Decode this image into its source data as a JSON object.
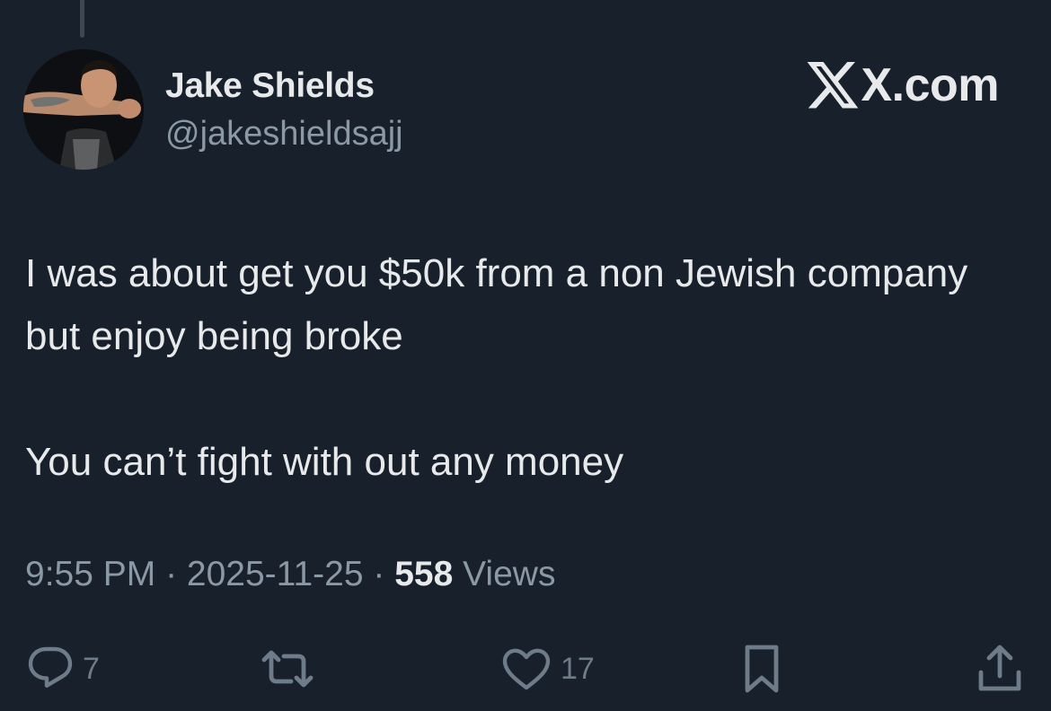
{
  "tweet": {
    "author": {
      "name": "Jake Shields",
      "handle": "@jakeshieldsajj"
    },
    "brand": {
      "text": "X.com"
    },
    "paragraphs": [
      "I was about get you $50k from a non Jewish company but enjoy being broke",
      "You can’t fight with out any money"
    ],
    "meta": {
      "time": "9:55 PM",
      "separator": " · ",
      "date": "2025-11-25",
      "views_count": "558",
      "views_label": "Views"
    },
    "actions": {
      "replies": "7",
      "likes": "17"
    }
  },
  "icons": {
    "reply": "reply-bubble-icon",
    "retweet": "retweet-arrows-icon",
    "like": "heart-icon",
    "bookmark": "bookmark-icon",
    "share": "share-upload-icon"
  },
  "colors": {
    "background": "#17202b",
    "text_primary": "#e7e9ea",
    "text_secondary": "#8b98a5",
    "icon": "#6e7b88"
  }
}
